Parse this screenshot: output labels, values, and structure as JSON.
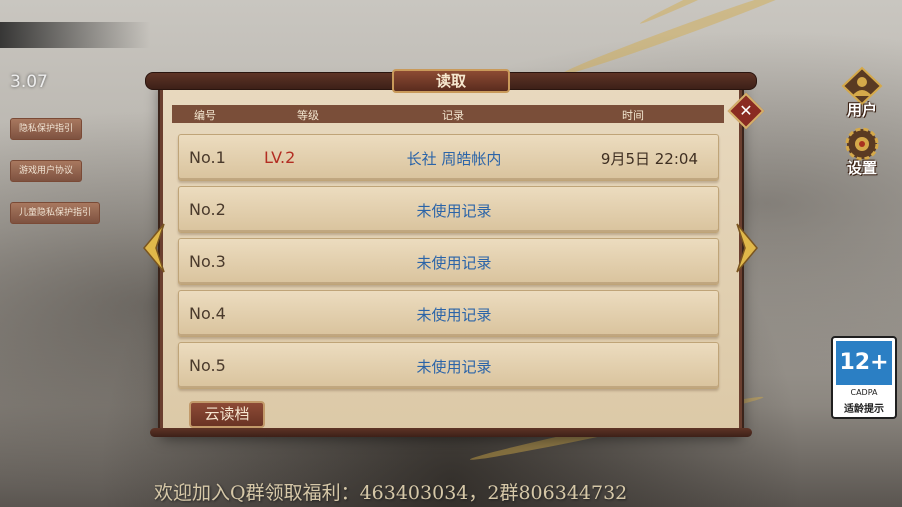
{
  "version": "3.07",
  "side_links": [
    "隐私保护指引",
    "游戏用户协议",
    "儿童隐私保护指引"
  ],
  "dialog": {
    "title": "读取",
    "close_label": "✕",
    "columns": [
      "编号",
      "等级",
      "记录",
      "时间"
    ],
    "slots": [
      {
        "num": "No.1",
        "level": "LV.2",
        "record": "长社  周皓帐内",
        "time": "9月5日 22:04"
      },
      {
        "num": "No.2",
        "level": "",
        "record": "未使用记录",
        "time": ""
      },
      {
        "num": "No.3",
        "level": "",
        "record": "未使用记录",
        "time": ""
      },
      {
        "num": "No.4",
        "level": "",
        "record": "未使用记录",
        "time": ""
      },
      {
        "num": "No.5",
        "level": "",
        "record": "未使用记录",
        "time": ""
      }
    ],
    "cloud_button": "云读档"
  },
  "right_menu": {
    "user_label": "用户",
    "settings_label": "设置"
  },
  "age_rating": {
    "rating": "12+",
    "org": "CADPA",
    "tip": "适龄提示"
  },
  "welcome_text": "欢迎加入Q群领取福利：463403034，2群806344732",
  "colors": {
    "accent_gold": "#d5a94a",
    "panel_brown": "#6b3f2f",
    "record_blue": "#2b64a8",
    "level_red": "#b32d22"
  }
}
